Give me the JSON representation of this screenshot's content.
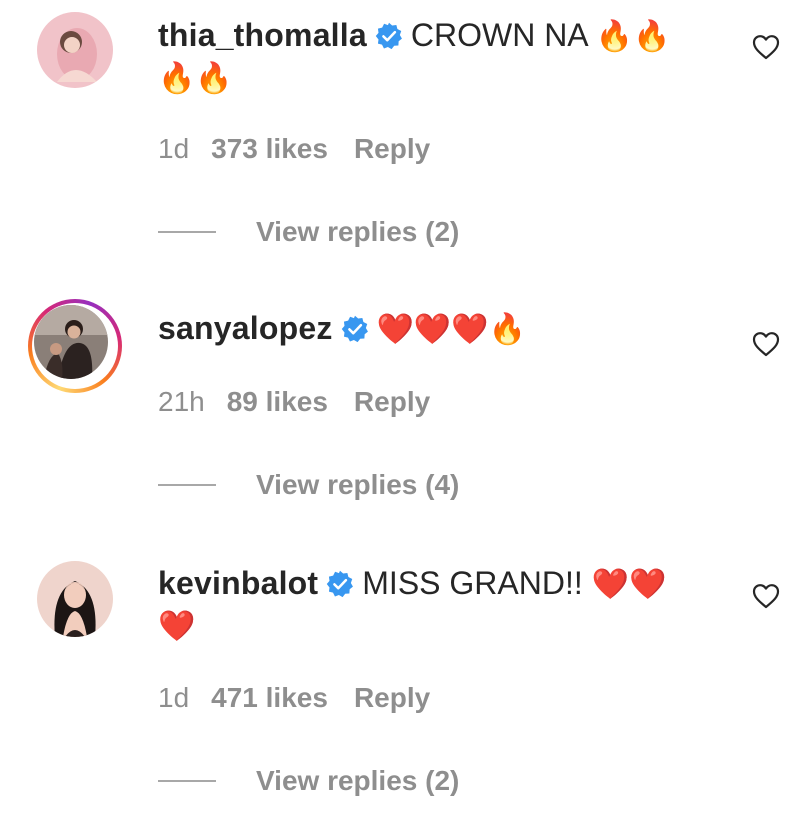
{
  "comments": [
    {
      "username": "thia_thomalla",
      "verified": true,
      "text": "CROWN NA",
      "emoji_line1": "🔥🔥",
      "emoji_line2": "🔥🔥",
      "time": "1d",
      "likes": "373 likes",
      "reply_label": "Reply",
      "view_replies": "View replies (2)",
      "has_story_ring": false
    },
    {
      "username": "sanyalopez",
      "verified": true,
      "text": "",
      "emoji_line1": "❤️❤️❤️🔥",
      "emoji_line2": "",
      "time": "21h",
      "likes": "89 likes",
      "reply_label": "Reply",
      "view_replies": "View replies (4)",
      "has_story_ring": true
    },
    {
      "username": "kevinbalot",
      "verified": true,
      "text": "MISS GRAND!!",
      "emoji_line1": "❤️❤️",
      "emoji_line2": "❤️",
      "time": "1d",
      "likes": "471 likes",
      "reply_label": "Reply",
      "view_replies": "View replies (2)",
      "has_story_ring": false
    }
  ],
  "colors": {
    "text_primary": "#262626",
    "text_secondary": "#8e8e8e",
    "verified_blue": "#3897f0",
    "heart_red": "#ed1c24",
    "fire_orange": "#f7931e"
  },
  "icons": {
    "like": "heart-outline-icon",
    "verified": "verified-badge-icon"
  }
}
